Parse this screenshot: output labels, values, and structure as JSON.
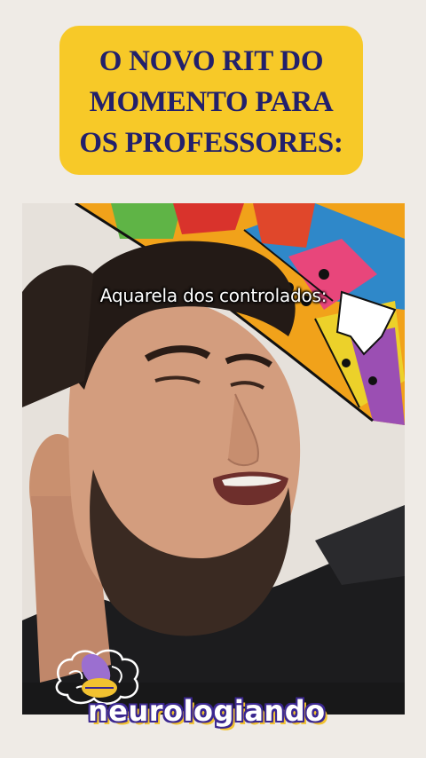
{
  "headline": {
    "lines": [
      "O NOVO RIT DO",
      "MOMENTO PARA",
      "OS PROFESSORES:"
    ]
  },
  "video": {
    "caption": "Aquarela dos controlados:"
  },
  "brand": {
    "name": "neurologiando"
  },
  "colors": {
    "background": "#efebe6",
    "headline_box": "#f7c928",
    "headline_text": "#22206b",
    "brand_outline": "#3b2790",
    "brand_shadow": "#f2c230"
  }
}
